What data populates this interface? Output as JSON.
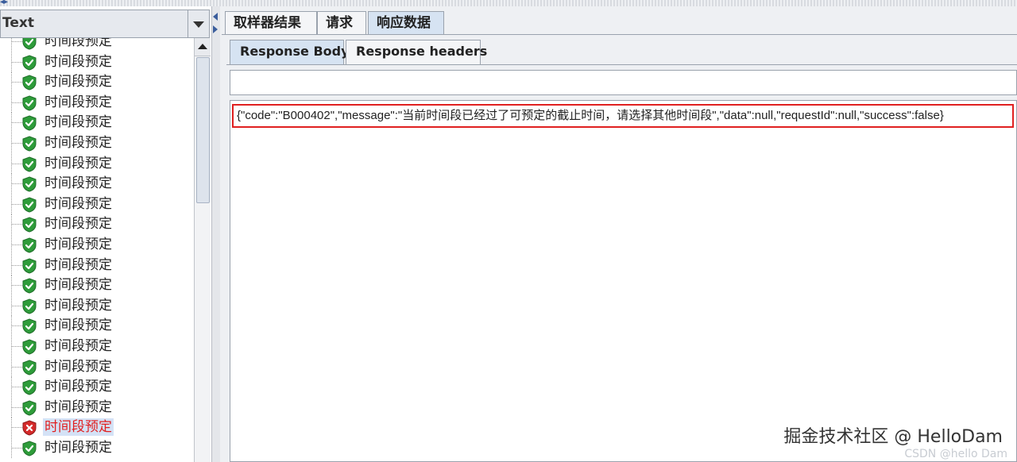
{
  "left_panel": {
    "combo_value": "Text",
    "rows": [
      {
        "label": "时间段预定",
        "status": "success"
      },
      {
        "label": "时间段预定",
        "status": "success"
      },
      {
        "label": "时间段预定",
        "status": "success"
      },
      {
        "label": "时间段预定",
        "status": "success"
      },
      {
        "label": "时间段预定",
        "status": "success"
      },
      {
        "label": "时间段预定",
        "status": "success"
      },
      {
        "label": "时间段预定",
        "status": "success"
      },
      {
        "label": "时间段预定",
        "status": "success"
      },
      {
        "label": "时间段预定",
        "status": "success"
      },
      {
        "label": "时间段预定",
        "status": "success"
      },
      {
        "label": "时间段预定",
        "status": "success"
      },
      {
        "label": "时间段预定",
        "status": "success"
      },
      {
        "label": "时间段预定",
        "status": "success"
      },
      {
        "label": "时间段预定",
        "status": "success"
      },
      {
        "label": "时间段预定",
        "status": "success"
      },
      {
        "label": "时间段预定",
        "status": "success"
      },
      {
        "label": "时间段预定",
        "status": "success"
      },
      {
        "label": "时间段预定",
        "status": "success"
      },
      {
        "label": "时间段预定",
        "status": "success"
      },
      {
        "label": "时间段预定",
        "status": "error"
      },
      {
        "label": "时间段预定",
        "status": "success"
      }
    ]
  },
  "tabs": {
    "main": [
      "取样器结果",
      "请求",
      "响应数据"
    ],
    "main_active": 2,
    "response": [
      "Response Body",
      "Response headers"
    ],
    "response_active": 0
  },
  "search": {
    "value": ""
  },
  "response_body": "{\"code\":\"B000402\",\"message\":\"当前时间段已经过了可预定的截止时间，请选择其他时间段\",\"data\":null,\"requestId\":null,\"success\":false}",
  "watermark": "掘金技术社区 @ HelloDam",
  "watermark_faint": "CSDN @hello Dam",
  "colors": {
    "success": "#2e9c3a",
    "error": "#d42a2a",
    "selection": "#d4e2f6",
    "highlight_border": "#e02020"
  }
}
